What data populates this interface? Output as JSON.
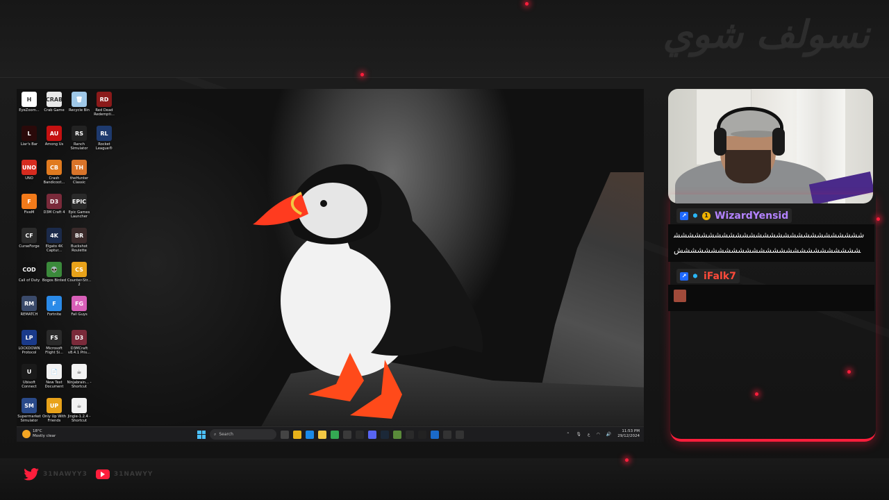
{
  "overlay": {
    "title_arabic": "نسولف شوي",
    "accent_color": "#ff1e3c",
    "socials": [
      {
        "platform": "twitter-icon",
        "handle": "31NAWYY3"
      },
      {
        "platform": "youtube-icon",
        "handle": "31NAWYY"
      }
    ]
  },
  "desktop": {
    "icons": [
      {
        "label": "EyeZoom...",
        "icon": "eyezoom-icon",
        "color": "#ffffff",
        "glyph": "H"
      },
      {
        "label": "Crab Game",
        "icon": "crab-game-icon",
        "color": "#e9e9e9",
        "glyph": "CRAB"
      },
      {
        "label": "Recycle Bin",
        "icon": "recycle-bin-icon",
        "color": "#9fc8e8",
        "glyph": "🗑"
      },
      {
        "label": "Red Dead Redempti...",
        "icon": "red-dead-icon",
        "color": "#8b1a1a",
        "glyph": "RD"
      },
      {
        "label": "Liar's Bar",
        "icon": "liars-bar-icon",
        "color": "#2a0a0a",
        "glyph": "L"
      },
      {
        "label": "Among Us",
        "icon": "among-us-icon",
        "color": "#c51111",
        "glyph": "AU"
      },
      {
        "label": "Ranch Simulator",
        "icon": "ranch-simulator-icon",
        "color": "#222222",
        "glyph": "RS"
      },
      {
        "label": "Rocket League®",
        "icon": "rocket-league-icon",
        "color": "#1e3a6e",
        "glyph": "RL"
      },
      {
        "label": "UNO",
        "icon": "uno-icon",
        "color": "#d62b1f",
        "glyph": "UNO"
      },
      {
        "label": "Crash Bandicoot...",
        "icon": "crash-bandicoot-icon",
        "color": "#e07a1f",
        "glyph": "CB"
      },
      {
        "label": "theHunter Classic",
        "icon": "thehunter-icon",
        "color": "#d9742a",
        "glyph": "TH"
      },
      {
        "label": "",
        "icon": "empty",
        "color": "transparent",
        "glyph": ""
      },
      {
        "label": "FiveM",
        "icon": "fivem-icon",
        "color": "#f27a1a",
        "glyph": "F"
      },
      {
        "label": "D3M Craft 4",
        "icon": "d3m-craft-icon",
        "color": "#7a2a3a",
        "glyph": "D3"
      },
      {
        "label": "Epic Games Launcher",
        "icon": "epic-games-icon",
        "color": "#2a2a2a",
        "glyph": "EPIC"
      },
      {
        "label": "",
        "icon": "empty",
        "color": "transparent",
        "glyph": ""
      },
      {
        "label": "CurseForge",
        "icon": "curseforge-icon",
        "color": "#2b2b2b",
        "glyph": "CF"
      },
      {
        "label": "Elgato 4K Captur...",
        "icon": "elgato-icon",
        "color": "#1b2a4a",
        "glyph": "4K"
      },
      {
        "label": "Buckshot Roulette",
        "icon": "buckshot-roulette-icon",
        "color": "#3a2a2a",
        "glyph": "BR"
      },
      {
        "label": "",
        "icon": "empty",
        "color": "transparent",
        "glyph": ""
      },
      {
        "label": "Call of Duty",
        "icon": "call-of-duty-icon",
        "color": "#111111",
        "glyph": "COD"
      },
      {
        "label": "Bogos Binted",
        "icon": "bogos-binted-icon",
        "color": "#3b8a3b",
        "glyph": "👽"
      },
      {
        "label": "Counter-Str... 2",
        "icon": "counter-strike-icon",
        "color": "#e8a21a",
        "glyph": "CS"
      },
      {
        "label": "",
        "icon": "empty",
        "color": "transparent",
        "glyph": ""
      },
      {
        "label": "REMATCH",
        "icon": "rematch-icon",
        "color": "#3a4a6a",
        "glyph": "RM"
      },
      {
        "label": "Fortnite",
        "icon": "fortnite-icon",
        "color": "#2a8ae8",
        "glyph": "F"
      },
      {
        "label": "Fall Guys",
        "icon": "fall-guys-icon",
        "color": "#d85fb8",
        "glyph": "FG"
      },
      {
        "label": "",
        "icon": "empty",
        "color": "transparent",
        "glyph": ""
      },
      {
        "label": "LOCKDOWN Protocol",
        "icon": "lockdown-protocol-icon",
        "color": "#1a3a8a",
        "glyph": "LP"
      },
      {
        "label": "Microsoft Flight Si...",
        "icon": "flight-simulator-icon",
        "color": "#2a2a2a",
        "glyph": "FS"
      },
      {
        "label": "D3MCraft v8.4.1 Pris...",
        "icon": "d3mcraft-icon",
        "color": "#7a2a3a",
        "glyph": "D3"
      },
      {
        "label": "",
        "icon": "empty",
        "color": "transparent",
        "glyph": ""
      },
      {
        "label": "Ubisoft Connect",
        "icon": "ubisoft-connect-icon",
        "color": "#1a1a1a",
        "glyph": "U"
      },
      {
        "label": "New Text Document",
        "icon": "text-document-icon",
        "color": "#f2f2f2",
        "glyph": "📄"
      },
      {
        "label": "Ninjabrain... - Shortcut",
        "icon": "java-icon",
        "color": "#f2f2f2",
        "glyph": "☕"
      },
      {
        "label": "",
        "icon": "empty",
        "color": "transparent",
        "glyph": ""
      },
      {
        "label": "Supermarket Simulator",
        "icon": "supermarket-simulator-icon",
        "color": "#2a4a8a",
        "glyph": "SM"
      },
      {
        "label": "Only Up With Friends",
        "icon": "only-up-icon",
        "color": "#e8a21a",
        "glyph": "UP"
      },
      {
        "label": "Jingle-1.2.4 - Shortcut",
        "icon": "java-icon",
        "color": "#f2f2f2",
        "glyph": "☕"
      }
    ]
  },
  "taskbar": {
    "weather_temp": "18°C",
    "weather_desc": "Mostly clear",
    "search_placeholder": "Search",
    "time": "11:53 PM",
    "date": "29/12/2024",
    "lang": "ع",
    "apps": [
      {
        "icon": "task-view-icon",
        "color": "#444444"
      },
      {
        "icon": "file-explorer-icon",
        "color": "#e8b21a"
      },
      {
        "icon": "edge-icon",
        "color": "#1a8ae8"
      },
      {
        "icon": "folder-icon",
        "color": "#f2c744"
      },
      {
        "icon": "chrome-icon",
        "color": "#34a853"
      },
      {
        "icon": "obs-icon",
        "color": "#3a3a3a"
      },
      {
        "icon": "capture-icon",
        "color": "#2a2a2a"
      },
      {
        "icon": "discord-icon",
        "color": "#5865f2"
      },
      {
        "icon": "steam-icon",
        "color": "#1b2838"
      },
      {
        "icon": "minecraft-icon",
        "color": "#5a8a3a"
      },
      {
        "icon": "epic-icon",
        "color": "#2a2a2a"
      },
      {
        "icon": "capcut-icon",
        "color": "#222222"
      },
      {
        "icon": "outlook-icon",
        "color": "#1a6ac8"
      },
      {
        "icon": "app-icon",
        "color": "#333333"
      },
      {
        "icon": "elgato-4k-icon",
        "color": "#333333"
      }
    ]
  },
  "chat": {
    "messages": [
      {
        "username": "WizardYensid",
        "username_color": "#b483ff",
        "badges": [
          "prime-icon",
          "cube-icon",
          "gold-icon"
        ],
        "text": "ششششششششششششششششششششششششششششششششششششششششششششششششششششششش"
      },
      {
        "username": "iFalk7",
        "username_color": "#ff4a3a",
        "badges": [
          "prime-icon",
          "cube-icon"
        ],
        "text": ""
      }
    ]
  }
}
